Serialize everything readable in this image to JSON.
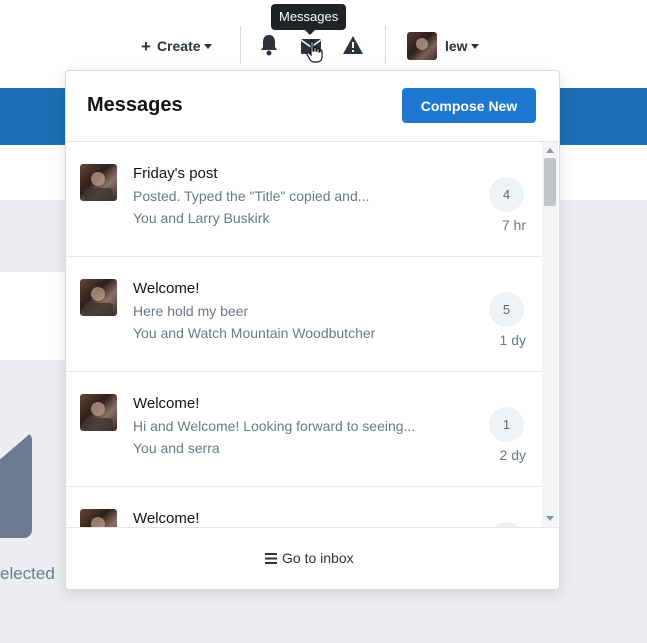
{
  "nav": {
    "create_label": "Create",
    "username": "lew",
    "tooltip": "Messages",
    "icons": [
      "bell-icon",
      "envelope-icon",
      "warning-icon"
    ]
  },
  "background": {
    "partial_label": "elected"
  },
  "messages_menu": {
    "title": "Messages",
    "compose_label": "Compose New",
    "footer_label": "Go to inbox",
    "items": [
      {
        "title": "Friday's post",
        "preview": "Posted. Typed the \"Title\" copied and...",
        "participants": "You and Larry Buskirk",
        "count": "4",
        "time": "7 hr"
      },
      {
        "title": "Welcome!",
        "preview": "Here hold my beer",
        "participants": "You and Watch Mountain Woodbutcher",
        "count": "5",
        "time": "1 dy"
      },
      {
        "title": "Welcome!",
        "preview": "Hi and Welcome! Looking forward to seeing...",
        "participants": "You and serra",
        "count": "1",
        "time": "2 dy"
      },
      {
        "title": "Welcome!",
        "preview": "",
        "participants": "",
        "count": "",
        "time": ""
      }
    ]
  },
  "colors": {
    "accent": "#1d77d1",
    "brand_bar": "#1d6fb5",
    "page_bg": "#eceef2",
    "muted_text": "#6b7886"
  }
}
